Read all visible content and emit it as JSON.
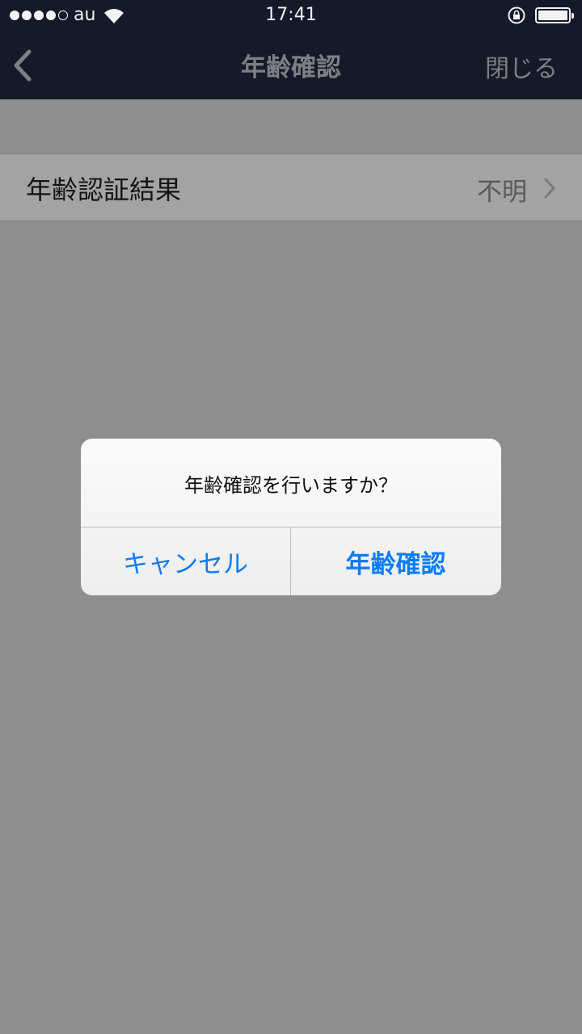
{
  "status_bar": {
    "carrier": "au",
    "time": "17:41"
  },
  "nav": {
    "title": "年齢確認",
    "close_label": "閉じる"
  },
  "row": {
    "label": "年齢認証結果",
    "value": "不明"
  },
  "alert": {
    "message": "年齢確認を行いますか？",
    "cancel_label": "キャンセル",
    "confirm_label": "年齢確認"
  },
  "colors": {
    "nav_bg": "#141a28",
    "dimmed_bg": "#8e8e90",
    "accent_blue": "#0b7cf6",
    "nav_text_dim": "#7d7f86"
  },
  "icons": {
    "back": "chevron-left-icon",
    "row_disclosure": "chevron-right-icon",
    "wifi": "wifi-icon",
    "orientation_lock": "rotation-lock-icon",
    "battery": "battery-icon"
  }
}
